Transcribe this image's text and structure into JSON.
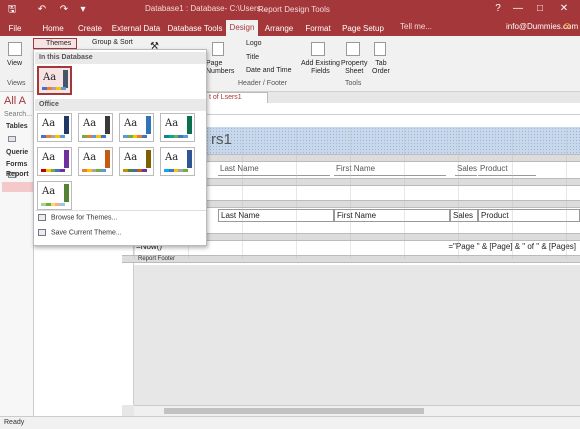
{
  "window": {
    "title": "Database1 : Database- C:\\Users...",
    "context_title": "Report Design Tools",
    "minimize": "—",
    "maximize": "□",
    "close": "✕",
    "help": "?"
  },
  "quick_access": {
    "save": "🖫",
    "undo": "↶",
    "redo": "↷",
    "more": "▾"
  },
  "tabs": [
    {
      "label": "File"
    },
    {
      "label": "Home"
    },
    {
      "label": "Create"
    },
    {
      "label": "External Data"
    },
    {
      "label": "Database Tools"
    },
    {
      "label": "Design"
    },
    {
      "label": "Arrange"
    },
    {
      "label": "Format"
    },
    {
      "label": "Page Setup"
    }
  ],
  "tell_me": "Tell me...",
  "user": "info@Dummies.com",
  "smiley": "☺",
  "ribbon": {
    "view_label": "View",
    "views_group": "Views",
    "themes_label": "Themes",
    "group_sort_label": "Group & Sort",
    "page_numbers_label": "Page\nNumbers",
    "logo_label": "Logo",
    "title_label": "Title",
    "date_time_label": "Date and Time",
    "header_footer_group": "Header / Footer",
    "add_fields_label": "Add Existing\nFields",
    "property_sheet_label": "Property\nSheet",
    "tab_order_label": "Tab\nOrder",
    "tools_group": "Tools"
  },
  "nav": {
    "title": "All A",
    "search_placeholder": "Search...",
    "tables": "Tables",
    "queries": "Querie",
    "forms": "Forms",
    "reports": "Report"
  },
  "doc_tab": "t of Lsers1",
  "report": {
    "title_text": "rs1",
    "header_labels": [
      "Last Name",
      "First Name",
      "Sales",
      "Product"
    ],
    "detail_fields": [
      "Last Name",
      "First Name",
      "Sales",
      "Product"
    ],
    "now_field": "=Now()",
    "page_field": "=\"Page \" & [Page] & \" of \" & [Pages]",
    "report_footer": "Report Footer"
  },
  "status": "Ready",
  "themes_menu": {
    "in_this_db": "In this Database",
    "office": "Office",
    "browse": "Browse for Themes...",
    "save": "Save Current Theme...",
    "glyph": "Aa"
  },
  "theme_colors": {
    "accent": "#a4373a",
    "themes": [
      {
        "bar": "#44546a",
        "stripe": [
          "#4472c4",
          "#ed7d31",
          "#a5a5a5",
          "#ffc000",
          "#5b9bd5"
        ]
      },
      {
        "bar": "#1f3864",
        "stripe": [
          "#4472c4",
          "#ed7d31",
          "#a5a5a5",
          "#ffc000",
          "#5b9bd5"
        ]
      },
      {
        "bar": "#3b3838",
        "stripe": [
          "#70ad47",
          "#ed7d31",
          "#5b9bd5",
          "#ffc000",
          "#4472c4"
        ]
      },
      {
        "bar": "#2e75b6",
        "stripe": [
          "#5b9bd5",
          "#70ad47",
          "#ffc000",
          "#ed7d31",
          "#4472c4"
        ]
      },
      {
        "bar": "#0b6e4f",
        "stripe": [
          "#1f7a8c",
          "#00a896",
          "#70ad47",
          "#4472c4",
          "#5b9bd5"
        ]
      },
      {
        "bar": "#7030a0",
        "stripe": [
          "#c00000",
          "#ffc000",
          "#70ad47",
          "#4472c4",
          "#7030a0"
        ]
      },
      {
        "bar": "#c55a11",
        "stripe": [
          "#ed7d31",
          "#ffc000",
          "#a5a5a5",
          "#70ad47",
          "#5b9bd5"
        ]
      },
      {
        "bar": "#7f6000",
        "stripe": [
          "#bf9000",
          "#548235",
          "#2e75b6",
          "#c55a11",
          "#7030a0"
        ]
      },
      {
        "bar": "#2f5597",
        "stripe": [
          "#00b0f0",
          "#4472c4",
          "#ffc000",
          "#a5a5a5",
          "#70ad47"
        ]
      },
      {
        "bar": "#548235",
        "stripe": [
          "#a9d18e",
          "#70ad47",
          "#ffd966",
          "#f4b183",
          "#9dc3e6"
        ]
      }
    ]
  }
}
